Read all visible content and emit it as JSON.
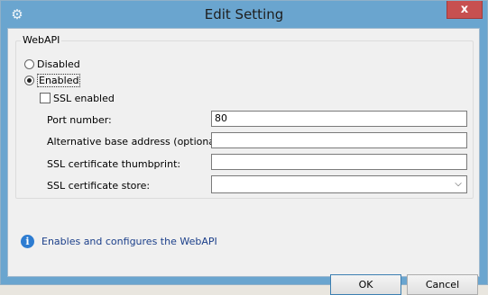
{
  "window": {
    "title": "Edit Setting",
    "close_label": "x"
  },
  "group": {
    "title": "WebAPI"
  },
  "options": {
    "disabled_label": "Disabled",
    "enabled_label": "Enabled",
    "selected": "Enabled",
    "ssl_enabled_label": "SSL enabled",
    "ssl_enabled_checked": false
  },
  "fields": {
    "port_label": "Port number:",
    "port_value": "80",
    "alt_base_label": "Alternative base address (optional):",
    "alt_base_value": "",
    "thumbprint_label": "SSL certificate thumbprint:",
    "thumbprint_value": "",
    "store_label": "SSL certificate store:",
    "store_value": ""
  },
  "info": {
    "text": "Enables and configures the WebAPI"
  },
  "buttons": {
    "ok_label": "OK",
    "cancel_label": "Cancel"
  },
  "icons": {
    "title_icon": "gear-icon",
    "info_icon": "info-icon",
    "dropdown_icon": "chevron-down-icon"
  },
  "colors": {
    "titlebar": "#6aa5cf",
    "close": "#c75050",
    "info_text": "#1b3f8a"
  }
}
